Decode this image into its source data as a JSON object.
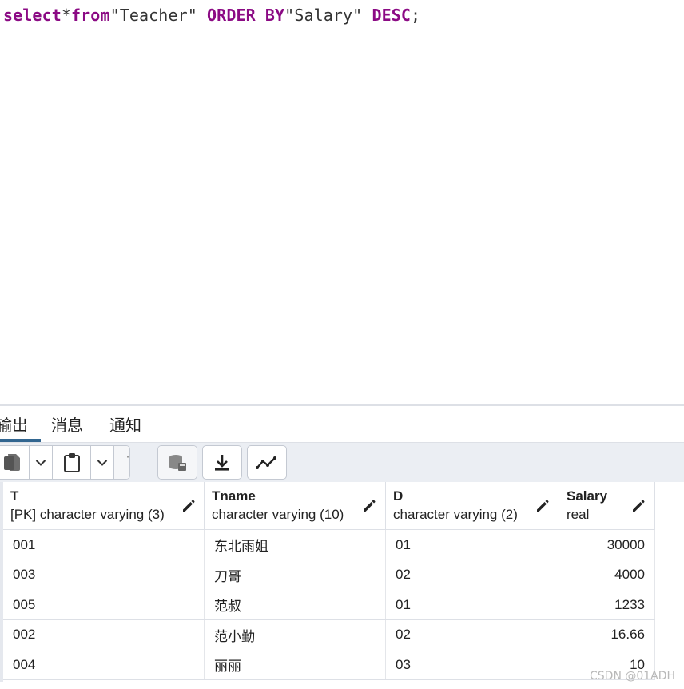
{
  "editor": {
    "sql": {
      "kw_select": "select",
      "star": "*",
      "kw_from": "from",
      "table": "\"Teacher\"",
      "kw_order_by": "ORDER BY",
      "column": "\"Salary\"",
      "kw_desc": "DESC",
      "semicolon": ";"
    }
  },
  "tabs": [
    {
      "label": "输出",
      "active": true
    },
    {
      "label": "消息",
      "active": false
    },
    {
      "label": "通知",
      "active": false
    }
  ],
  "toolbar": {
    "icons": [
      "copy-icon",
      "chevron-down-icon",
      "paste-icon",
      "chevron-down-icon",
      "delete-icon",
      "save-data-icon",
      "download-icon",
      "graph-icon"
    ]
  },
  "grid": {
    "columns": [
      {
        "name": "T",
        "type": "[PK] character varying (3)"
      },
      {
        "name": "Tname",
        "type": "character varying (10)"
      },
      {
        "name": "D",
        "type": "character varying (2)"
      },
      {
        "name": "Salary",
        "type": "real"
      }
    ],
    "rows": [
      [
        "001",
        "东北雨姐",
        "01",
        "30000"
      ],
      [
        "003",
        "刀哥",
        "02",
        "4000"
      ],
      [
        "005",
        "范叔",
        "01",
        "1233"
      ],
      [
        "002",
        "范小勤",
        "02",
        "16.66"
      ],
      [
        "004",
        "丽丽",
        "03",
        "10"
      ]
    ]
  },
  "watermark": "CSDN @01ADH",
  "colors": {
    "keyword": "#8b0a84",
    "tab_accent": "#326690",
    "toolbar_bg": "#ebeef3"
  }
}
